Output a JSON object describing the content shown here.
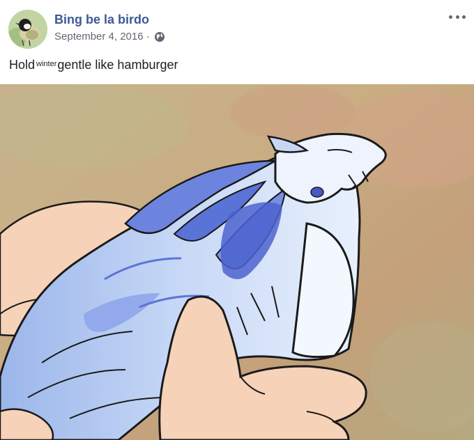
{
  "post": {
    "author": "Bing be la birdo",
    "date": "September 4, 2016",
    "separator": "·",
    "privacy_icon": "globe-icon",
    "more_icon": "more-options-icon",
    "caption": {
      "before": "Hold",
      "small": "winter",
      "after": "gentle like hamburger"
    }
  },
  "colors": {
    "author_link": "#3b5998",
    "meta_text": "#616770",
    "caption_text": "#1c1e21"
  }
}
